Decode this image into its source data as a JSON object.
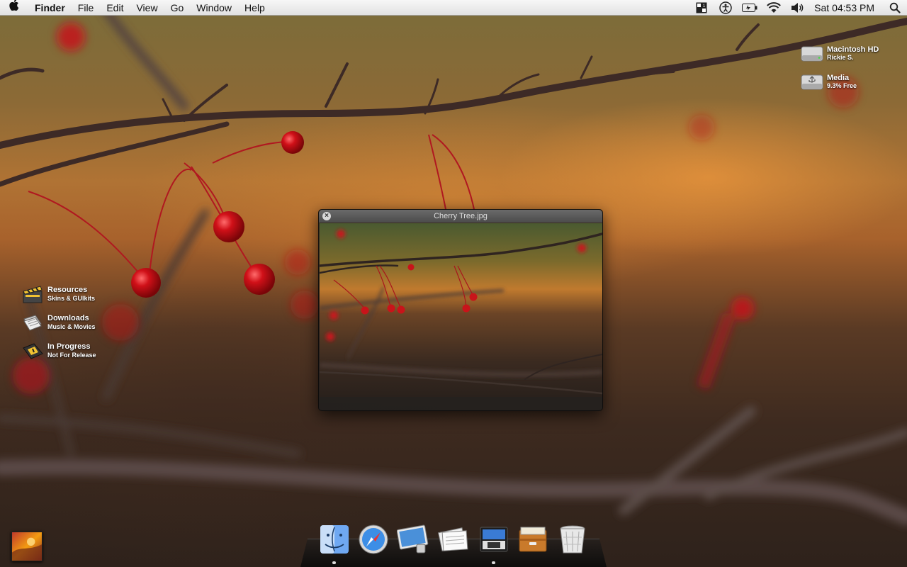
{
  "menubar": {
    "apple_icon": "apple-icon",
    "app_name": "Finder",
    "menus": [
      "File",
      "Edit",
      "View",
      "Go",
      "Window",
      "Help"
    ],
    "status_icons": [
      "spaces-icon",
      "accessibility-icon",
      "battery-icon",
      "wifi-icon",
      "volume-icon"
    ],
    "clock": "Sat 04:53 PM",
    "spotlight_icon": "spotlight-search-icon"
  },
  "desktop": {
    "disks": [
      {
        "name": "Macintosh HD",
        "detail": "Rickie S."
      },
      {
        "name": "Media",
        "detail": "9.3% Free"
      }
    ],
    "stacks": [
      {
        "name": "Resources",
        "detail": "Skins & GUIkits"
      },
      {
        "name": "Downloads",
        "detail": "Music & Movies"
      },
      {
        "name": "In Progress",
        "detail": "Not For Release"
      }
    ]
  },
  "quicklook": {
    "title": "Cherry Tree.jpg",
    "close_label": "×"
  },
  "dock": {
    "items": [
      "finder-icon",
      "safari-icon",
      "preview-icon",
      "news-icon",
      "itunes-icon",
      "archive-icon",
      "trash-icon"
    ],
    "running": [
      "finder-icon",
      "itunes-icon"
    ]
  },
  "colors": {
    "cherry": "#c8141a",
    "branch": "#3d2a26",
    "menubar": "#ececec"
  }
}
